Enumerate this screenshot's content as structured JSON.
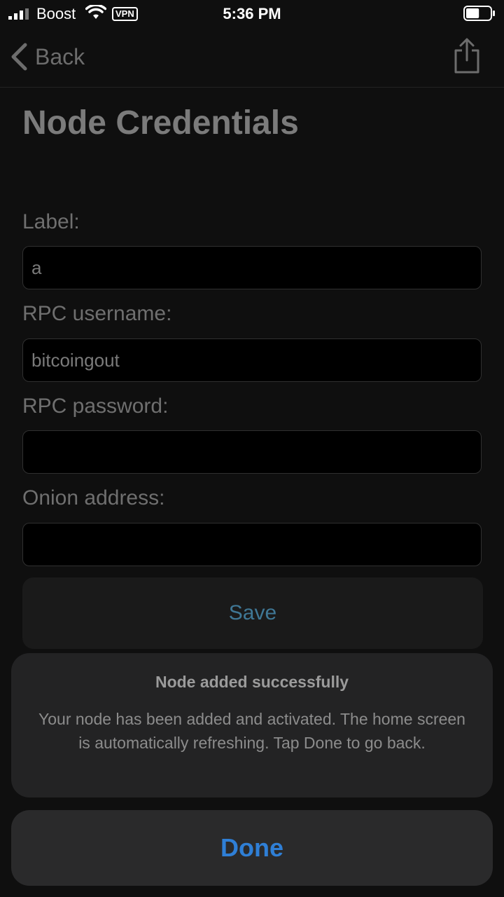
{
  "status_bar": {
    "carrier": "Boost",
    "vpn": "VPN",
    "time": "5:36 PM",
    "battery_level": 0.55
  },
  "nav": {
    "back_label": "Back",
    "share_icon": "share-icon"
  },
  "page": {
    "title": "Node Credentials"
  },
  "form": {
    "label": {
      "label": "Label:",
      "value": "a"
    },
    "rpc_username": {
      "label": "RPC username:",
      "value": "bitcoingout"
    },
    "rpc_password": {
      "label": "RPC password:",
      "value": ""
    },
    "onion_address": {
      "label": "Onion address:",
      "value": ""
    },
    "save_label": "Save"
  },
  "alert": {
    "title": "Node added successfully",
    "message": "Your node has been added and activated. The home screen is automatically refreshing. Tap Done to go back.",
    "done_label": "Done"
  },
  "colors": {
    "background": "#0f0f0f",
    "accent": "#2f7fd6",
    "save_text": "#3f7795"
  }
}
